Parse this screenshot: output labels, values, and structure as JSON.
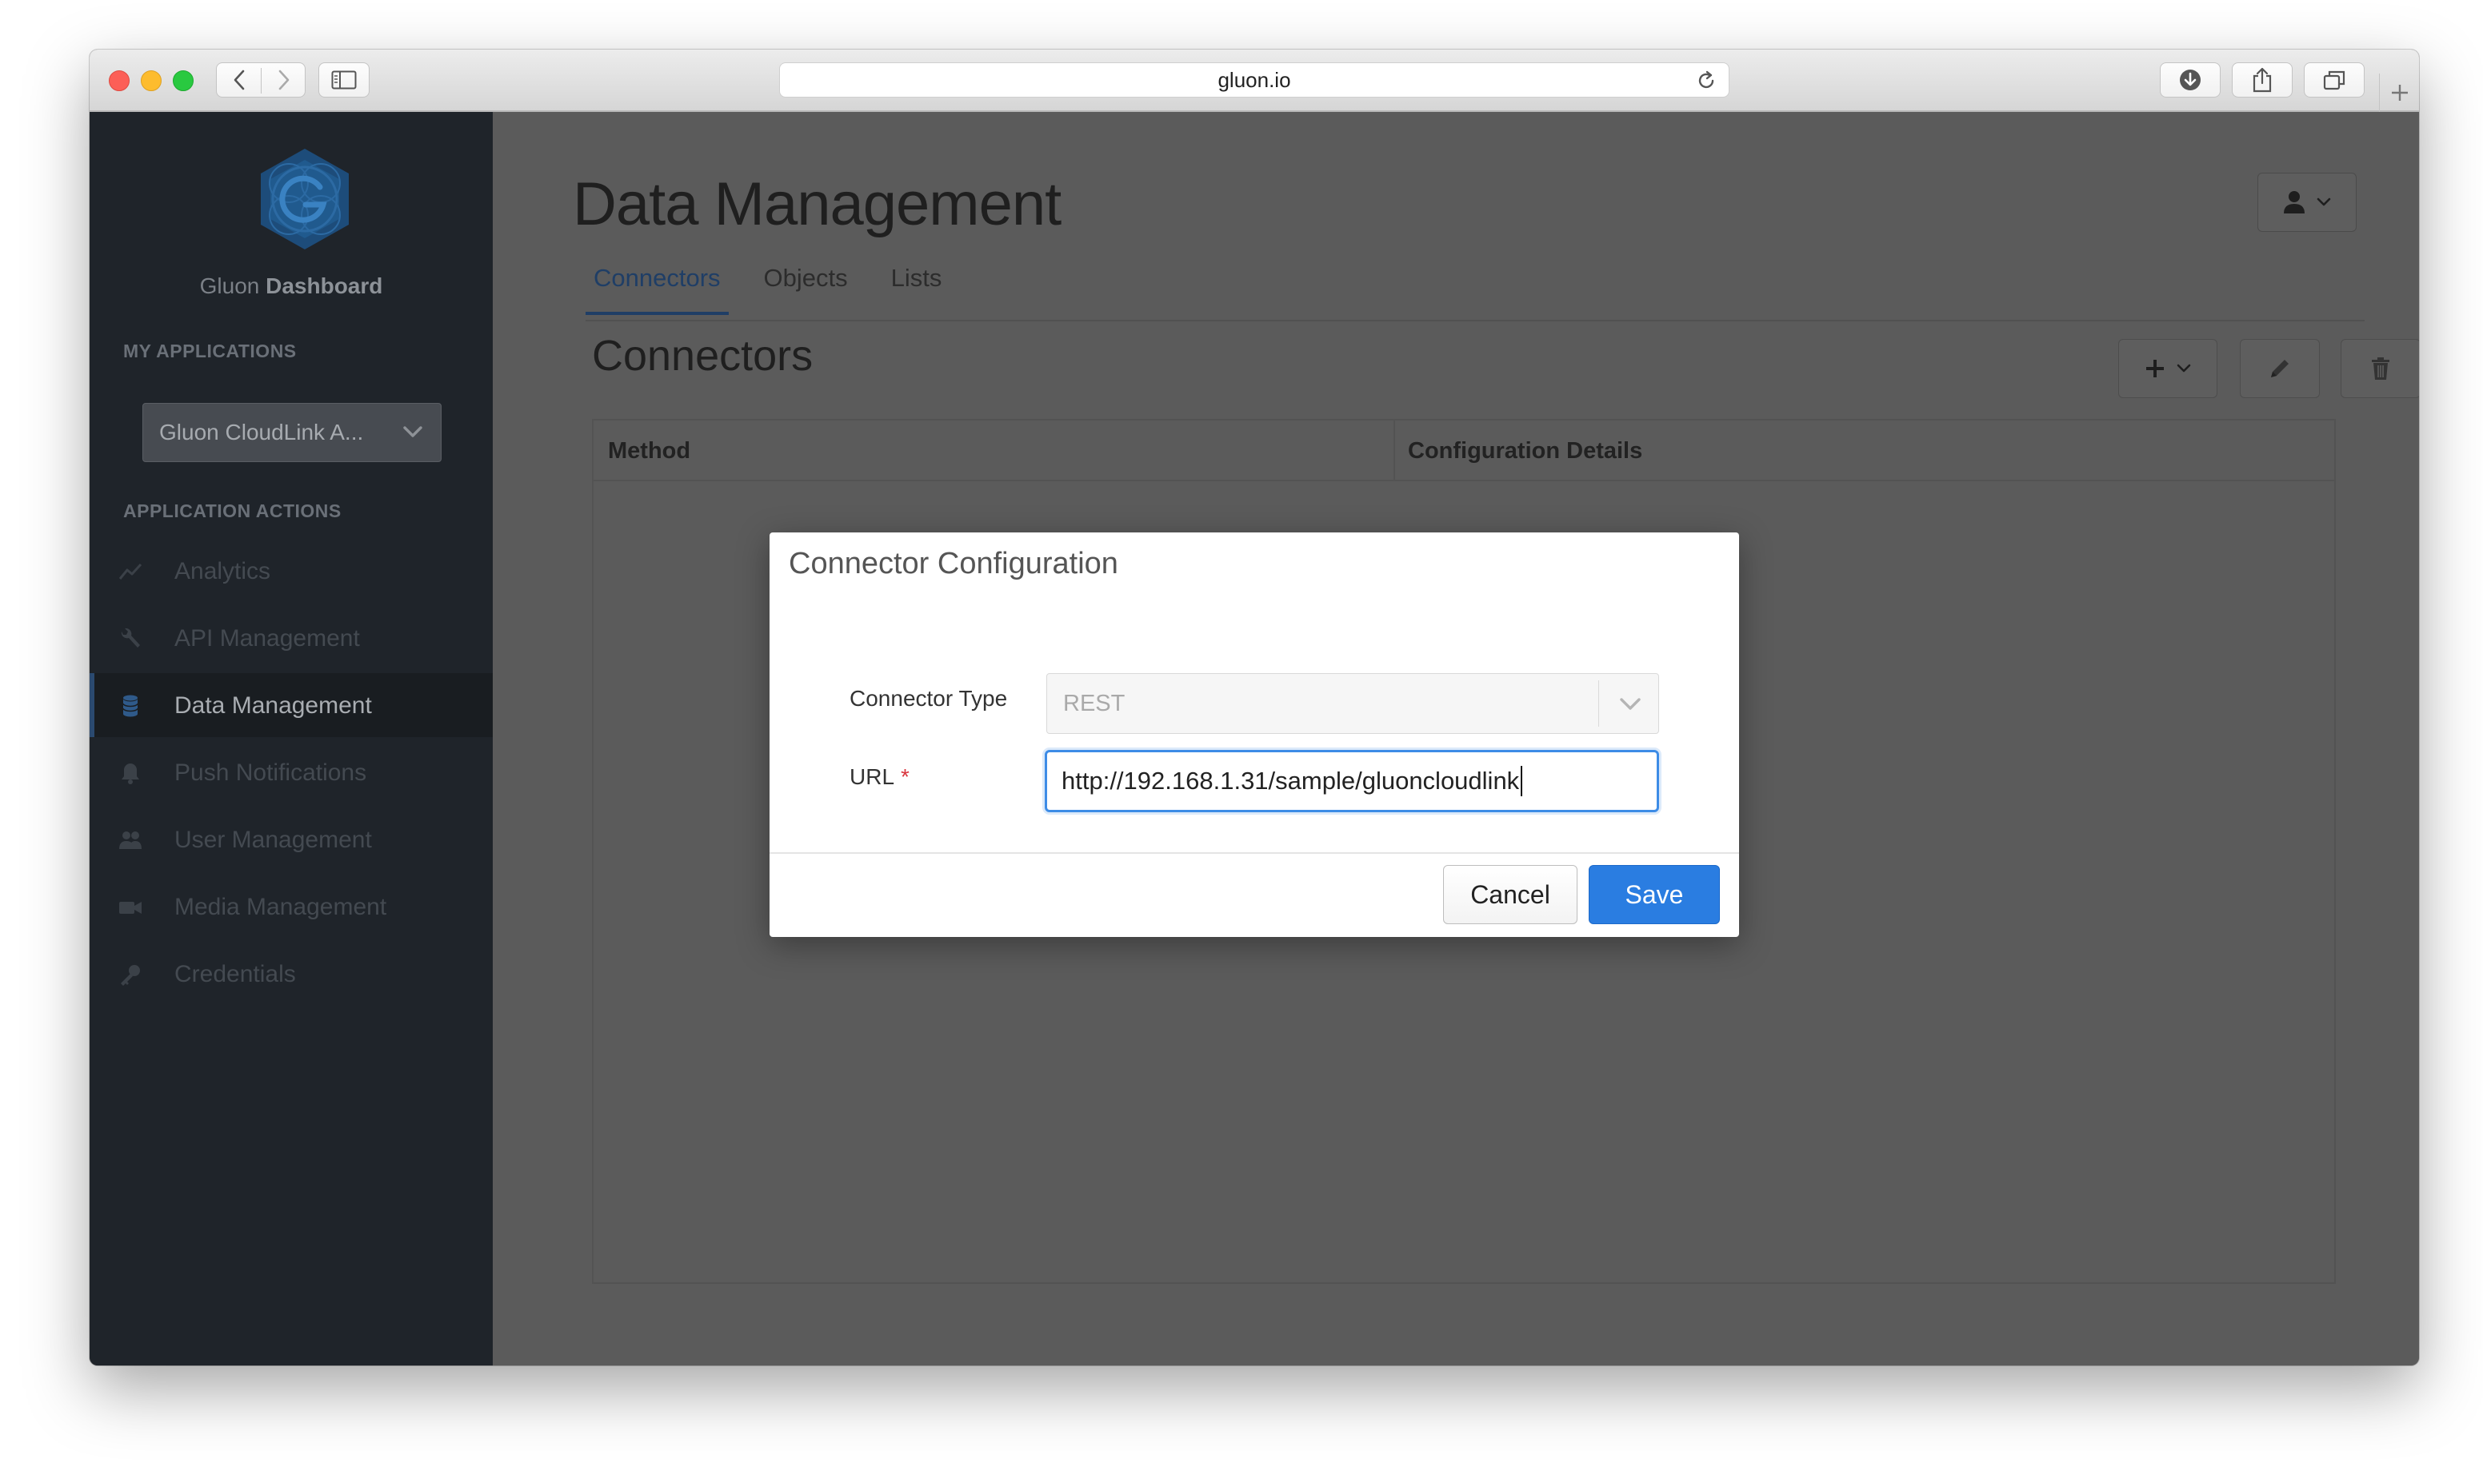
{
  "browser": {
    "url": "gluon.io"
  },
  "sidebar": {
    "brand_light": "Gluon",
    "brand_bold": "Dashboard",
    "my_applications_label": "MY APPLICATIONS",
    "selected_app": "Gluon CloudLink A...",
    "application_actions_label": "APPLICATION ACTIONS",
    "items": [
      {
        "label": "Analytics",
        "icon": "chart-line-icon",
        "active": false
      },
      {
        "label": "API Management",
        "icon": "wrench-icon",
        "active": false
      },
      {
        "label": "Data Management",
        "icon": "database-icon",
        "active": true
      },
      {
        "label": "Push Notifications",
        "icon": "bell-icon",
        "active": false
      },
      {
        "label": "User Management",
        "icon": "users-icon",
        "active": false
      },
      {
        "label": "Media Management",
        "icon": "video-camera-icon",
        "active": false
      },
      {
        "label": "Credentials",
        "icon": "key-icon",
        "active": false
      }
    ]
  },
  "main": {
    "page_title": "Data Management",
    "tabs": [
      {
        "label": "Connectors",
        "active": true
      },
      {
        "label": "Objects",
        "active": false
      },
      {
        "label": "Lists",
        "active": false
      }
    ],
    "section_title": "Connectors",
    "table": {
      "columns": [
        "Method",
        "Configuration Details"
      ]
    }
  },
  "modal": {
    "title": "Connector Configuration",
    "connector_type_label": "Connector Type",
    "connector_type_value": "REST",
    "url_label": "URL",
    "url_required_mark": "*",
    "url_value": "http://192.168.1.31/sample/gluoncloudlink",
    "cancel_label": "Cancel",
    "save_label": "Save"
  },
  "colors": {
    "accent": "#2a7de1",
    "sidebar_bg": "#1f242a",
    "required": "#d9363e"
  }
}
